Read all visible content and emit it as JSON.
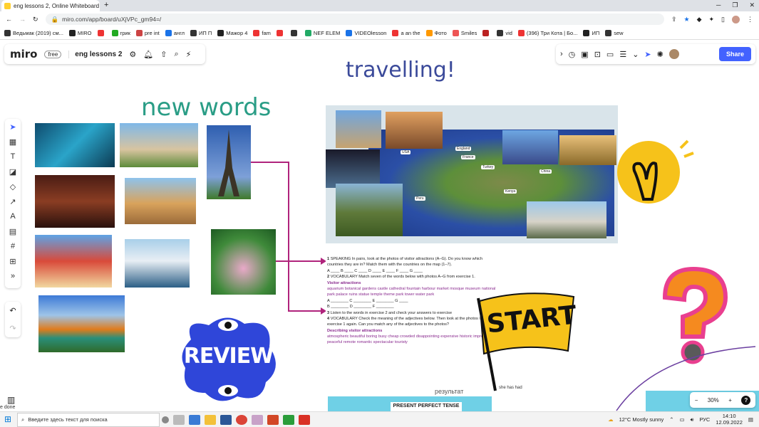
{
  "browser": {
    "tab_title": "eng lessons 2, Online Whiteboard",
    "new_tab": "+",
    "url": "miro.com/app/board/uXjVPc_gm94=/",
    "bookmarks": [
      "Ведьмак (2019) см...",
      "MIRO",
      "",
      "грик",
      "pre int",
      "англ",
      "ИП П",
      "Мажор 4",
      "fam",
      "",
      "",
      "NEF ELEM",
      "VIDEOlesson",
      "a an the",
      "Фото",
      "Smiles",
      "",
      "vid",
      "(396) Три Кота | Бо...",
      "ИП",
      "sew"
    ]
  },
  "miro": {
    "logo": "miro",
    "plan": "free",
    "board_name": "eng lessons 2",
    "share": "Share",
    "zoom": "30%",
    "help": "?",
    "zoom_minus": "−",
    "zoom_plus": "+"
  },
  "board": {
    "title": "travelling!",
    "subtitle": "new words",
    "review": "REVIEW",
    "start": "START",
    "results": "результат",
    "present_perfect": "PRESENT PERFECT TENSE",
    "she_has_had": "she has had"
  },
  "map_labels": [
    "USA",
    "England",
    "France",
    "Turkey",
    "China",
    "Kenya",
    "Peru"
  ],
  "worksheet": {
    "ex1": "SPEAKING In pairs, look at the photos of visitor attractions (A–G). Do you know which countries they are in? Match them with the countries on the map (1–7).",
    "ex1_blanks": "A ____  B ____  C ____  D ____  E ____  F ____  G ____",
    "ex2": "VOCABULARY Match seven of the words below with photos A–G from exercise 1.",
    "ex2_head": "Visitor attractions",
    "ex2_words": "aquarium  botanical gardens  castle  cathedral  fountain  harbour  market  mosque  museum  national park  palace  ruins  statue  temple  theme park  tower  water park",
    "ex2_blanks1": "A ________  C ________  E ________  G ____",
    "ex2_blanks2": "B ________  D ________  F ________",
    "ex3": "Listen to the words in exercise 2 and check your answers to exercise",
    "ex4": "VOCABULARY Check the meaning of the adjectives below. Then look at the photos in exercise 1 again. Can you match any of the adjectives to the photos?",
    "ex4_head": "Describing visitor attractions",
    "ex4_words": "atmospheric  beautiful  boring  busy  cheap  crowded  disappointing  expensive  historic  impressive  peaceful  remote  romantic  spectacular  touristy"
  },
  "taskbar": {
    "search_placeholder": "Введите здесь текст для поиска",
    "weather": "12°C  Mostly sunny",
    "lang": "РУС",
    "time": "14:10",
    "date": "12.09.2022",
    "status_left": "e done"
  }
}
